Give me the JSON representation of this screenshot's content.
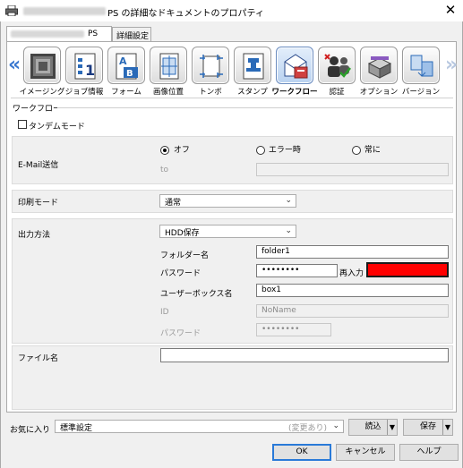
{
  "window": {
    "title": "PS の詳細なドキュメントのプロパティ",
    "close_glyph": "✕"
  },
  "tabs": [
    {
      "label": "PS"
    },
    {
      "label": "詳細設定"
    }
  ],
  "toolbar": {
    "prev_arrow": "«",
    "next_arrow": "»",
    "items": [
      {
        "label": "イメージング",
        "icon": "imaging-icon"
      },
      {
        "label": "ジョブ情報",
        "icon": "job-info-icon"
      },
      {
        "label": "フォーム",
        "icon": "form-icon"
      },
      {
        "label": "画像位置",
        "icon": "image-position-icon"
      },
      {
        "label": "トンボ",
        "icon": "crop-mark-icon"
      },
      {
        "label": "スタンプ",
        "icon": "stamp-icon"
      },
      {
        "label": "ワークフロー",
        "icon": "workflow-icon",
        "active": true
      },
      {
        "label": "認証",
        "icon": "authentication-icon"
      },
      {
        "label": "オプション",
        "icon": "option-icon"
      },
      {
        "label": "バージョン",
        "icon": "version-icon"
      }
    ]
  },
  "workflow": {
    "group_label": "ワークフロー",
    "tandem_label": "タンデムモード",
    "tandem_checked": false,
    "email_label": "E-Mail送信",
    "email_options": [
      "オフ",
      "エラー時",
      "常に"
    ],
    "email_selected": "オフ",
    "to_label": "to",
    "to_value": "",
    "print_mode_label": "印刷モード",
    "print_mode_value": "通常",
    "output_label": "出力方法",
    "output_value": "HDD保存",
    "folder_label": "フォルダー名",
    "folder_value": "folder1",
    "password_label": "パスワード",
    "password_value": "••••••••",
    "reenter_label": "再入力",
    "reenter_value": "",
    "reenter_color": "#ff0000",
    "userbox_label": "ユーザーボックス名",
    "userbox_value": "box1",
    "id_label": "ID",
    "id_value": "NoName",
    "id_password_label": "パスワード",
    "id_password_value": "••••••••",
    "filename_label": "ファイル名",
    "filename_value": ""
  },
  "favorites": {
    "label": "お気に入り",
    "value": "標準設定",
    "changed": "(変更あり)",
    "load_label": "読込",
    "save_label": "保存"
  },
  "buttons": {
    "ok": "OK",
    "cancel": "キャンセル",
    "help": "ヘルプ"
  },
  "colors": {
    "accent": "#2a7ad8",
    "arrow": "#3a78d0"
  }
}
